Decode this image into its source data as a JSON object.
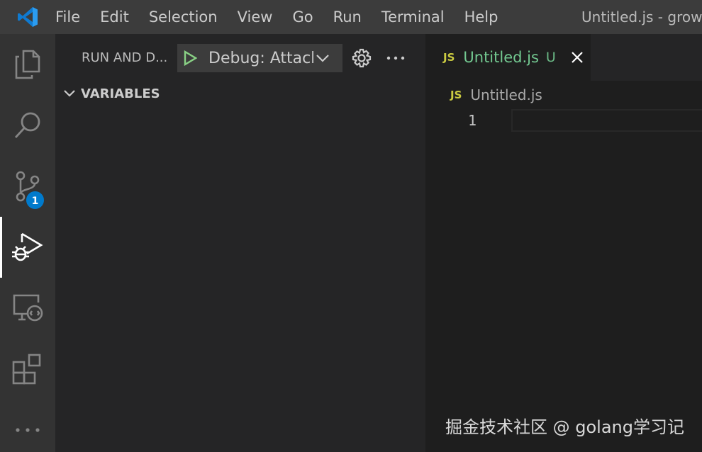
{
  "titlebar": {
    "menu": [
      "File",
      "Edit",
      "Selection",
      "View",
      "Go",
      "Run",
      "Terminal",
      "Help"
    ],
    "window_title": "Untitled.js - growi"
  },
  "activitybar": {
    "items": [
      "explorer-icon",
      "search-icon",
      "source-control-icon",
      "run-debug-icon",
      "remote-explorer-icon",
      "extensions-icon",
      "more-icon"
    ],
    "source_control_badge": "1",
    "accent": "#007acc"
  },
  "sidebar": {
    "title": "RUN AND D...",
    "debug_config": "Debug: Attach",
    "section_title": "VARIABLES"
  },
  "editor": {
    "tab": {
      "icon": "JS",
      "label": "Untitled.js",
      "status": "U"
    },
    "breadcrumb": {
      "icon": "JS",
      "label": "Untitled.js"
    },
    "line_numbers": [
      "1"
    ],
    "colors": {
      "untracked": "#73c991",
      "js": "#cbcb41"
    }
  },
  "watermark": "掘金技术社区 @ golang学习记"
}
